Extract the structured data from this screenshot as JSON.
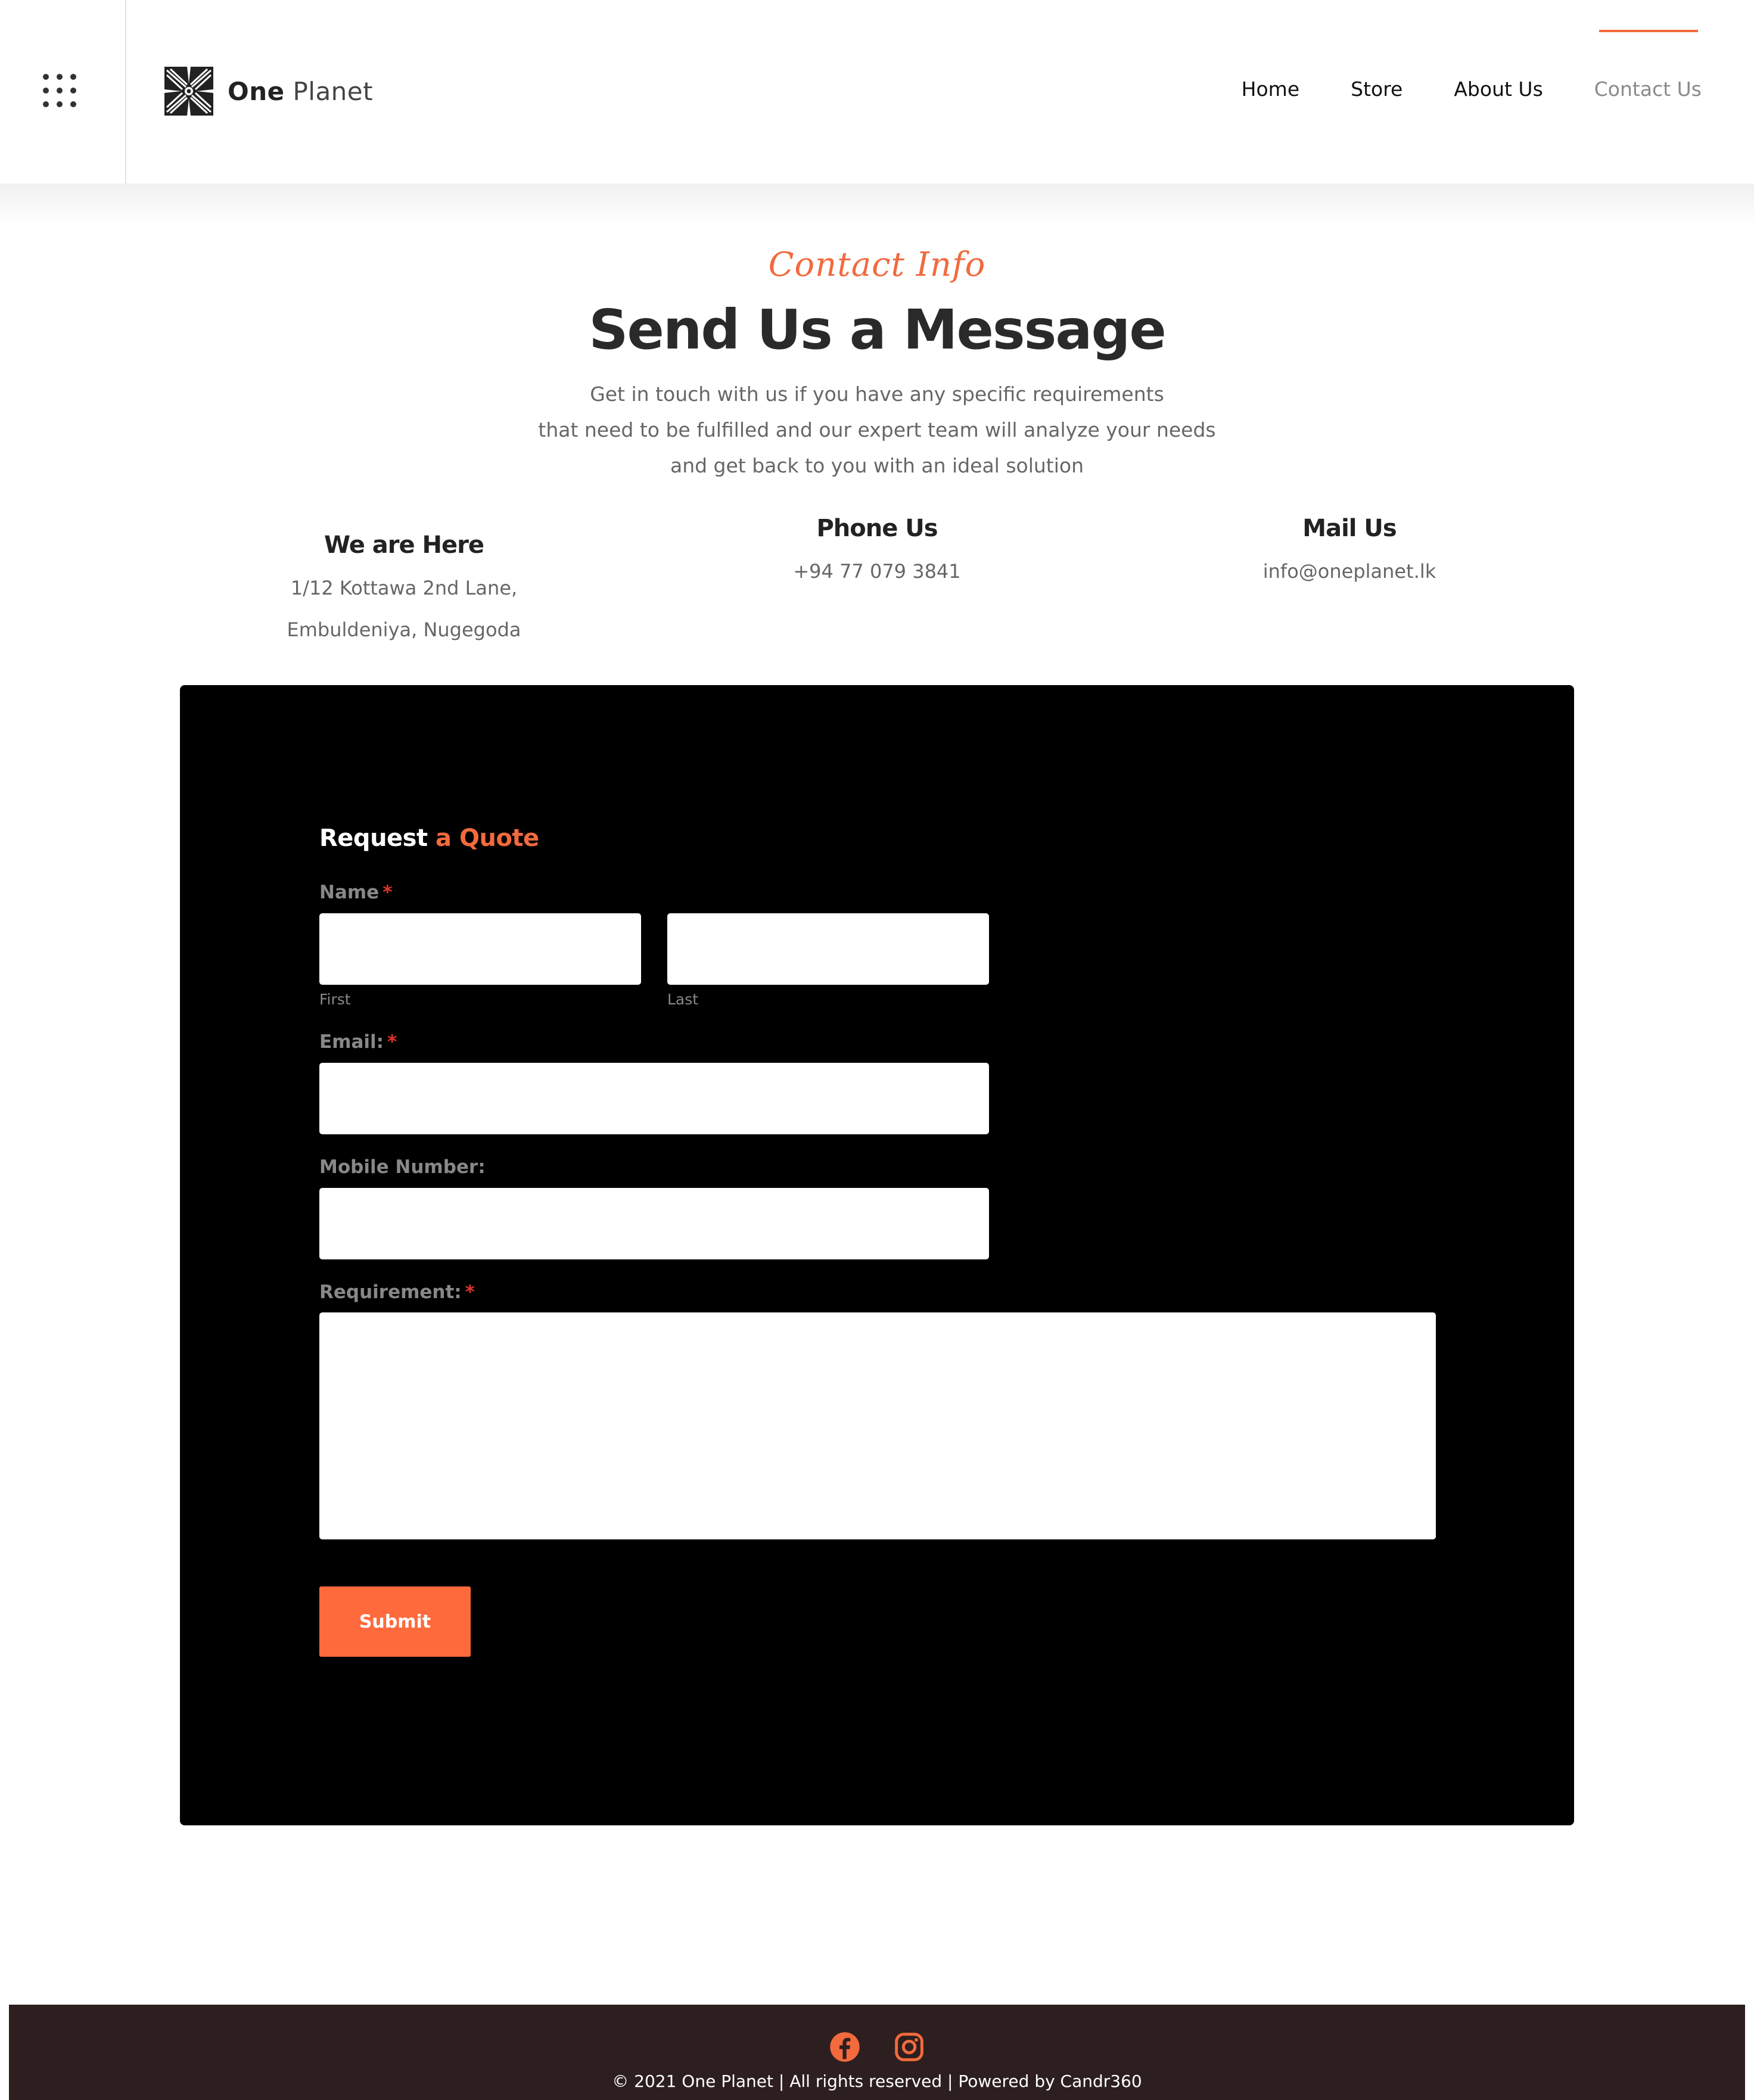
{
  "header": {
    "logo_text_1": "One",
    "logo_text_2": "Planet",
    "nav": [
      {
        "label": "Home"
      },
      {
        "label": "Store"
      },
      {
        "label": "About Us"
      },
      {
        "label": "Contact Us",
        "active": true
      }
    ]
  },
  "intro": {
    "eyebrow": "Contact Info",
    "title": "Send Us a Message",
    "lines": [
      "Get in touch with us if you have any specific requirements",
      "that need to be fulfilled and our expert team will analyze your needs",
      "and get back to you with an ideal solution"
    ]
  },
  "contact": {
    "location": {
      "heading": "We are Here",
      "line1": "1/12 Kottawa 2nd Lane,",
      "line2": "Embuldeniya, Nugegoda"
    },
    "phone": {
      "heading": "Phone Us",
      "value": "+94 77 079 3841"
    },
    "mail": {
      "heading": "Mail Us",
      "value": "info@oneplanet.lk"
    }
  },
  "form": {
    "title_main": "Request",
    "title_accent": "a Quote",
    "name_label": "Name",
    "first_sub": "First",
    "last_sub": "Last",
    "email_label": "Email:",
    "mobile_label": "Mobile Number:",
    "requirement_label": "Requirement:",
    "required_mark": "*",
    "submit_label": "Submit",
    "values": {
      "first": "",
      "last": "",
      "email": "",
      "mobile": "",
      "requirement": ""
    }
  },
  "footer": {
    "social": [
      "facebook-icon",
      "instagram-icon"
    ],
    "copyright": "© 2021 One Planet | All rights reserved | Powered by Candr360"
  },
  "colors": {
    "accent": "#f26a3d",
    "button": "#ff6a3d",
    "panel": "#000000",
    "footer": "#2d1f1f",
    "required": "#e0342b"
  }
}
